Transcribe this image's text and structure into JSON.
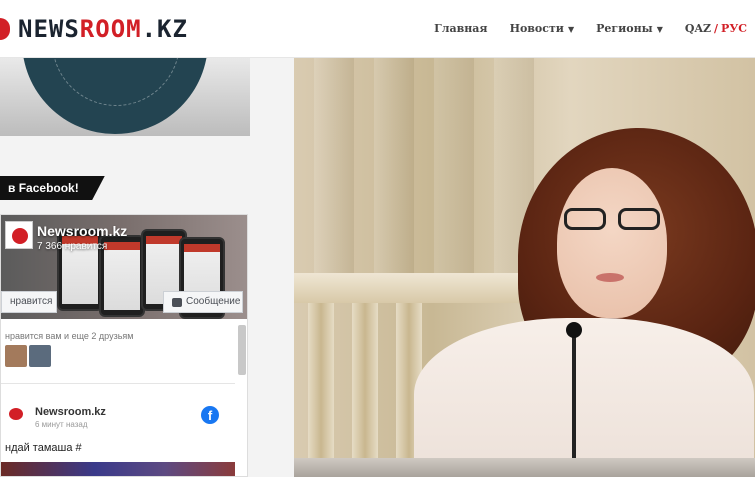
{
  "header": {
    "logo_text_main": "NEWS",
    "logo_text_accent": "ROOM",
    "logo_text_tail": ".KZ",
    "nav": [
      {
        "label": "Главная",
        "has_dropdown": false
      },
      {
        "label": "Новости",
        "has_dropdown": true
      },
      {
        "label": "Регионы",
        "has_dropdown": true
      }
    ],
    "lang": {
      "qaz": "QAZ",
      "separator": "/",
      "rus": "РУС"
    },
    "colors": {
      "accent": "#d21f26",
      "text": "#1b2430"
    }
  },
  "sidebar": {
    "fb_section_title": "в Facebook!",
    "fb_widget": {
      "page_name": "Newsroom.kz",
      "likes_text": "7 366 нравится",
      "like_button": "нравится",
      "message_button": "Сообщение",
      "friends_text": "нравится вам и еще 2 друзьям",
      "post_author": "Newsroom.kz",
      "post_time": "6 минут назад",
      "post_text": "ндай тамаша #"
    }
  },
  "icons": {
    "facebook": "facebook-icon",
    "message": "message-icon",
    "caret": "chevron-down-icon"
  }
}
